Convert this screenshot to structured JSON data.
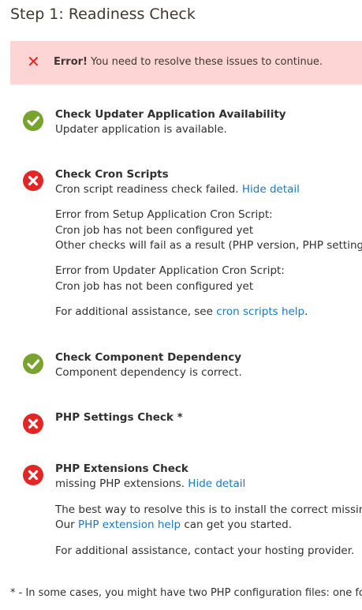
{
  "page_title": "Step 1: Readiness Check",
  "error_banner": {
    "icon": "close-icon",
    "bold": "Error!",
    "text": " You need to resolve these issues to continue."
  },
  "checks": {
    "updater": {
      "status": "success",
      "title": "Check Updater Application Availability",
      "message": "Updater application is available."
    },
    "cron": {
      "status": "error",
      "title": "Check Cron Scripts",
      "message": "Cron script readiness check failed. ",
      "toggle_link": "Hide detail",
      "setup_header": "Error from Setup Application Cron Script:",
      "setup_line1": "Cron job has not been configured yet",
      "setup_line2": "Other checks will fail as a result (PHP version, PHP settings, a",
      "updater_header": "Error from Updater Application Cron Script:",
      "updater_line1": "Cron job has not been configured yet",
      "help_prefix": "For additional assistance, see ",
      "help_link": "cron scripts help",
      "help_suffix": "."
    },
    "dependency": {
      "status": "success",
      "title": "Check Component Dependency",
      "message": "Component dependency is correct."
    },
    "php_settings": {
      "status": "error",
      "title": "PHP Settings Check *"
    },
    "php_extensions": {
      "status": "error",
      "title": "PHP Extensions Check",
      "message": "missing PHP extensions. ",
      "toggle_link": "Hide detail",
      "resolve_line": "The best way to resolve this is to install the correct missing e",
      "help_prefix": "Our ",
      "help_link": "PHP extension help",
      "help_suffix": " can get you started.",
      "contact_line": "For additional assistance, contact your hosting provider."
    }
  },
  "footnote": "* - In some cases, you might have two PHP configuration files: one fo",
  "colors": {
    "success": "#79a22e",
    "error": "#e22626",
    "link": "#1979c3",
    "banner_bg": "#fdd5d5"
  }
}
